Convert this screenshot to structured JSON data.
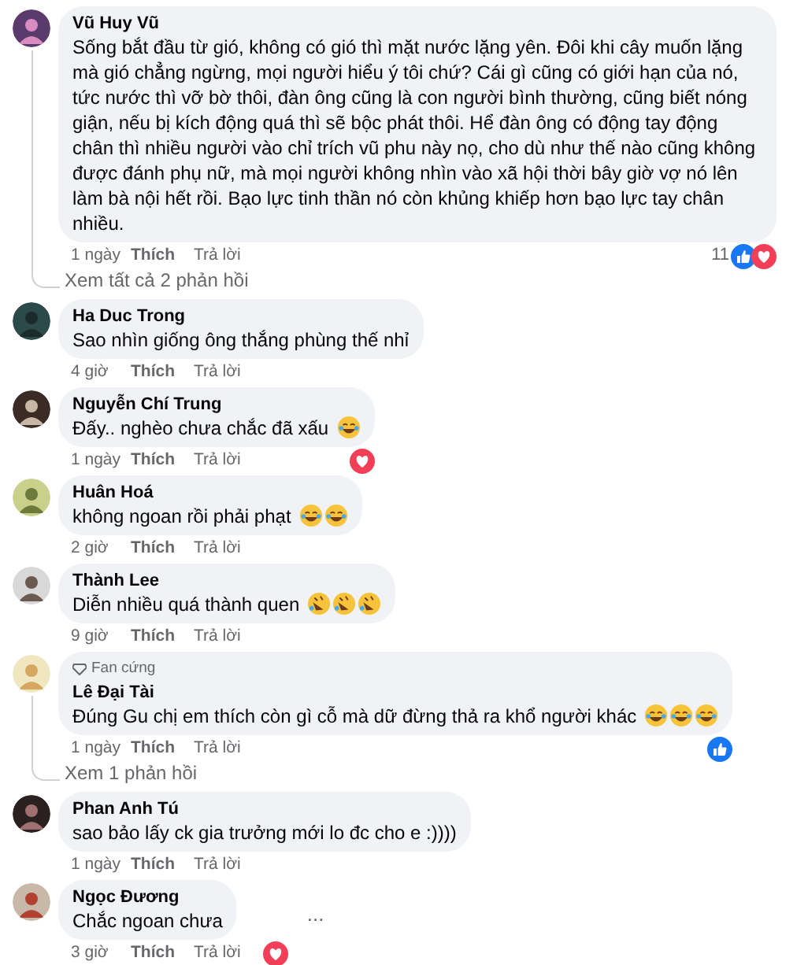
{
  "comments": [
    {
      "name": "Vũ Huy Vũ",
      "text": "Sống bắt đầu từ gió, không có gió thì mặt nước lặng yên. Đôi khi cây muốn lặng mà gió chẳng ngừng, mọi người hiểu ý tôi chứ? Cái gì cũng có giới hạn của nó, tức nước thì vỡ bờ thôi, đàn ông cũng là con người bình thường, cũng biết nóng giận, nếu bị kích động quá thì sẽ bộc phát thôi. Hể đàn ông có động tay động chân thì nhiều người vào chỉ trích vũ phu này nọ, cho dù như thế nào cũng không được đánh phụ nữ, mà mọi người không nhìn vào xã hội thời bây giờ vợ nó lên làm bà nội hết rồi. Bạo lực tinh thần nó còn khủng khiếp hơn bạo lực tay chân nhiều.",
      "time": "1 ngày",
      "like": "Thích",
      "reply": "Trả lời",
      "reaction_count": "11",
      "reactions": [
        {
          "kind": "like"
        },
        {
          "kind": "love"
        }
      ],
      "replies_link": "Xem tất cả 2 phản hồi"
    },
    {
      "name": "Ha Duc Trong",
      "text": "Sao nhìn giống ông thắng phùng thế nhỉ",
      "time": "4 giờ",
      "like": "Thích",
      "reply": "Trả lời"
    },
    {
      "name": "Nguyễn Chí Trung",
      "text": "Đấy.. nghèo chưa chắc đã xấu",
      "emojis": [
        {
          "kind": "tears-of-joy"
        }
      ],
      "time": "1 ngày",
      "like": "Thích",
      "reply": "Trả lời",
      "reactions": [
        {
          "kind": "love"
        }
      ]
    },
    {
      "name": "Huân Hoá",
      "text": "không ngoan rồi phải phạt",
      "emojis": [
        {
          "kind": "tears-of-joy"
        },
        {
          "kind": "tears-of-joy"
        }
      ],
      "time": "2 giờ",
      "like": "Thích",
      "reply": "Trả lời"
    },
    {
      "name": "Thành Lee",
      "text": "Diễn nhiều quá thành quen",
      "emojis": [
        {
          "kind": "rolling-laugh"
        },
        {
          "kind": "rolling-laugh"
        },
        {
          "kind": "rolling-laugh"
        }
      ],
      "time": "9 giờ",
      "like": "Thích",
      "reply": "Trả lời"
    },
    {
      "badge": "Fan cứng",
      "name": "Lê Đại Tài",
      "text": "Đúng Gu chị em thích còn gì cỗ mà dữ đừng thả ra khổ người khác",
      "emojis": [
        {
          "kind": "tears-of-joy"
        },
        {
          "kind": "tears-of-joy"
        },
        {
          "kind": "tears-of-joy"
        }
      ],
      "time": "1 ngày",
      "like": "Thích",
      "reply": "Trả lời",
      "reactions": [
        {
          "kind": "like"
        }
      ],
      "replies_link": "Xem 1 phản hồi"
    },
    {
      "name": "Phan Anh Tú",
      "text": "sao bảo lấy ck gia trưởng mới lo đc cho e :))))",
      "time": "1 ngày",
      "like": "Thích",
      "reply": "Trả lời"
    },
    {
      "name": "Ngọc Đương",
      "text": "Chắc ngoan chưa",
      "more": "...",
      "time": "3 giờ",
      "like": "Thích",
      "reply": "Trả lời",
      "reactions": [
        {
          "kind": "love"
        }
      ]
    }
  ]
}
